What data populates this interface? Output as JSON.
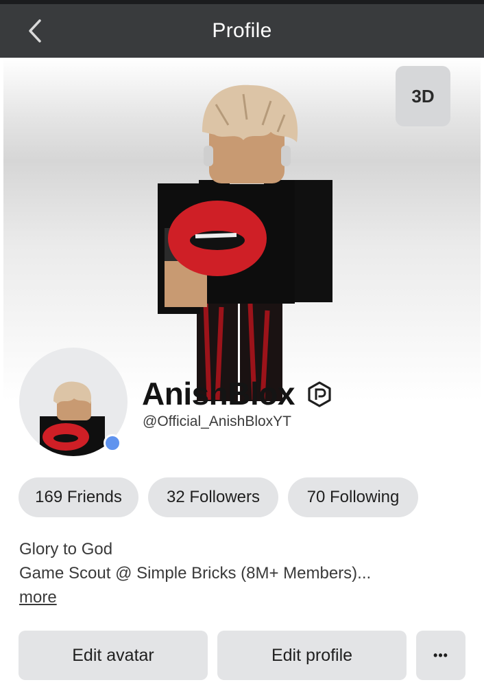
{
  "header": {
    "title": "Profile",
    "back_icon": "chevron-left-icon"
  },
  "hero": {
    "view_3d_label": "3D"
  },
  "profile": {
    "display_name": "AnishBlox",
    "username": "@Official_AnishBloxYT",
    "premium_icon": "premium-badge-icon",
    "online_status_color": "#5f93ee"
  },
  "stats": [
    {
      "label": "169 Friends"
    },
    {
      "label": "32 Followers"
    },
    {
      "label": "70 Following"
    }
  ],
  "bio": {
    "lines": [
      "Glory to God",
      "Game Scout @ Simple Bricks (8M+ Members)..."
    ],
    "more_label": "more"
  },
  "actions": {
    "edit_avatar_label": "Edit avatar",
    "edit_profile_label": "Edit profile",
    "more_options_label": "•••"
  },
  "colors": {
    "header_bg": "#393b3d",
    "pill_bg": "#e3e4e6",
    "button_bg": "#e3e4e6"
  }
}
